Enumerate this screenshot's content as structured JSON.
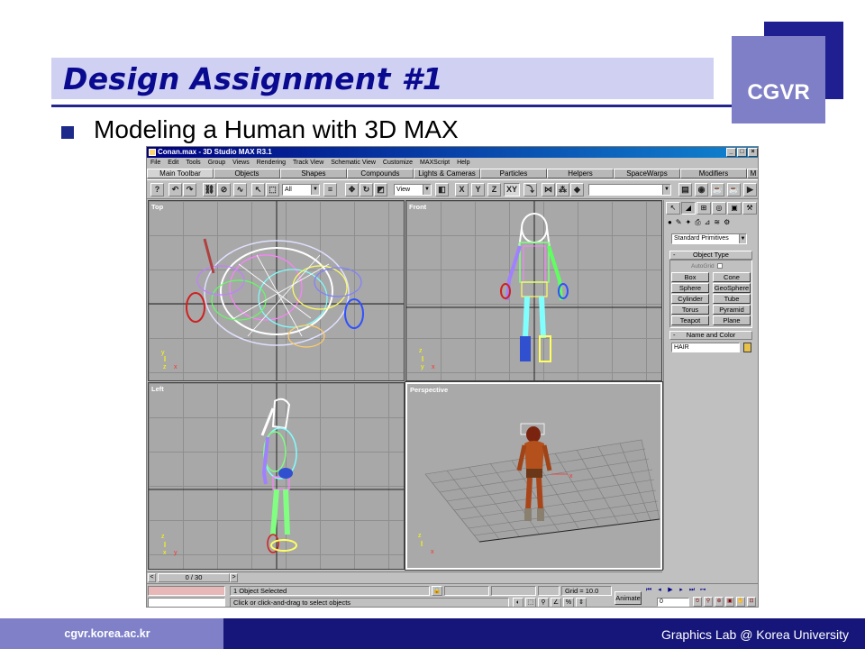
{
  "slide": {
    "title": "Design Assignment #1",
    "logo": "CGVR",
    "bullet": "Modeling a Human with 3D MAX",
    "footer_left": "cgvr.korea.ac.kr",
    "footer_right": "Graphics Lab @ Korea University"
  },
  "app": {
    "window_title": "Conan.max - 3D Studio MAX R3.1",
    "window_buttons": [
      "_",
      "□",
      "×"
    ],
    "menu": [
      "File",
      "Edit",
      "Tools",
      "Group",
      "Views",
      "Rendering",
      "Track View",
      "Schematic View",
      "Customize",
      "MAXScript",
      "Help"
    ],
    "tabs": [
      "Main Toolbar",
      "Objects",
      "Shapes",
      "Compounds",
      "Lights & Cameras",
      "Particles",
      "Helpers",
      "SpaceWarps",
      "Modifiers",
      "M"
    ],
    "toolbar": {
      "selection_filter": "All",
      "ref_coord": "View",
      "axis_buttons": [
        "X",
        "Y",
        "Z",
        "XY"
      ],
      "named_selection": ""
    },
    "viewports": {
      "top": "Top",
      "front": "Front",
      "left": "Left",
      "perspective": "Perspective"
    },
    "command_panel": {
      "category": "Standard Primitives",
      "object_type_header": "Object Type",
      "autogrid_label": "AutoGrid",
      "primitives": [
        "Box",
        "Cone",
        "Sphere",
        "GeoSphere",
        "Cylinder",
        "Tube",
        "Torus",
        "Pyramid",
        "Teapot",
        "Plane"
      ],
      "name_color_header": "Name and Color",
      "object_name": "HAIR",
      "object_color": "#e8c14a"
    },
    "time_slider": "0 / 30",
    "status": {
      "selection": "1 Object Selected",
      "prompt": "Click or click-and-drag to select objects",
      "grid": "Grid = 10.0",
      "animate": "Animate",
      "frame": "0"
    }
  },
  "colors": {
    "title_text": "#0a0a90",
    "title_band": "#cfd0f2",
    "footer_dark": "#15157a",
    "footer_light": "#7f80c8",
    "logo_light": "#7e7fc6",
    "logo_dark": "#1f1f92"
  }
}
